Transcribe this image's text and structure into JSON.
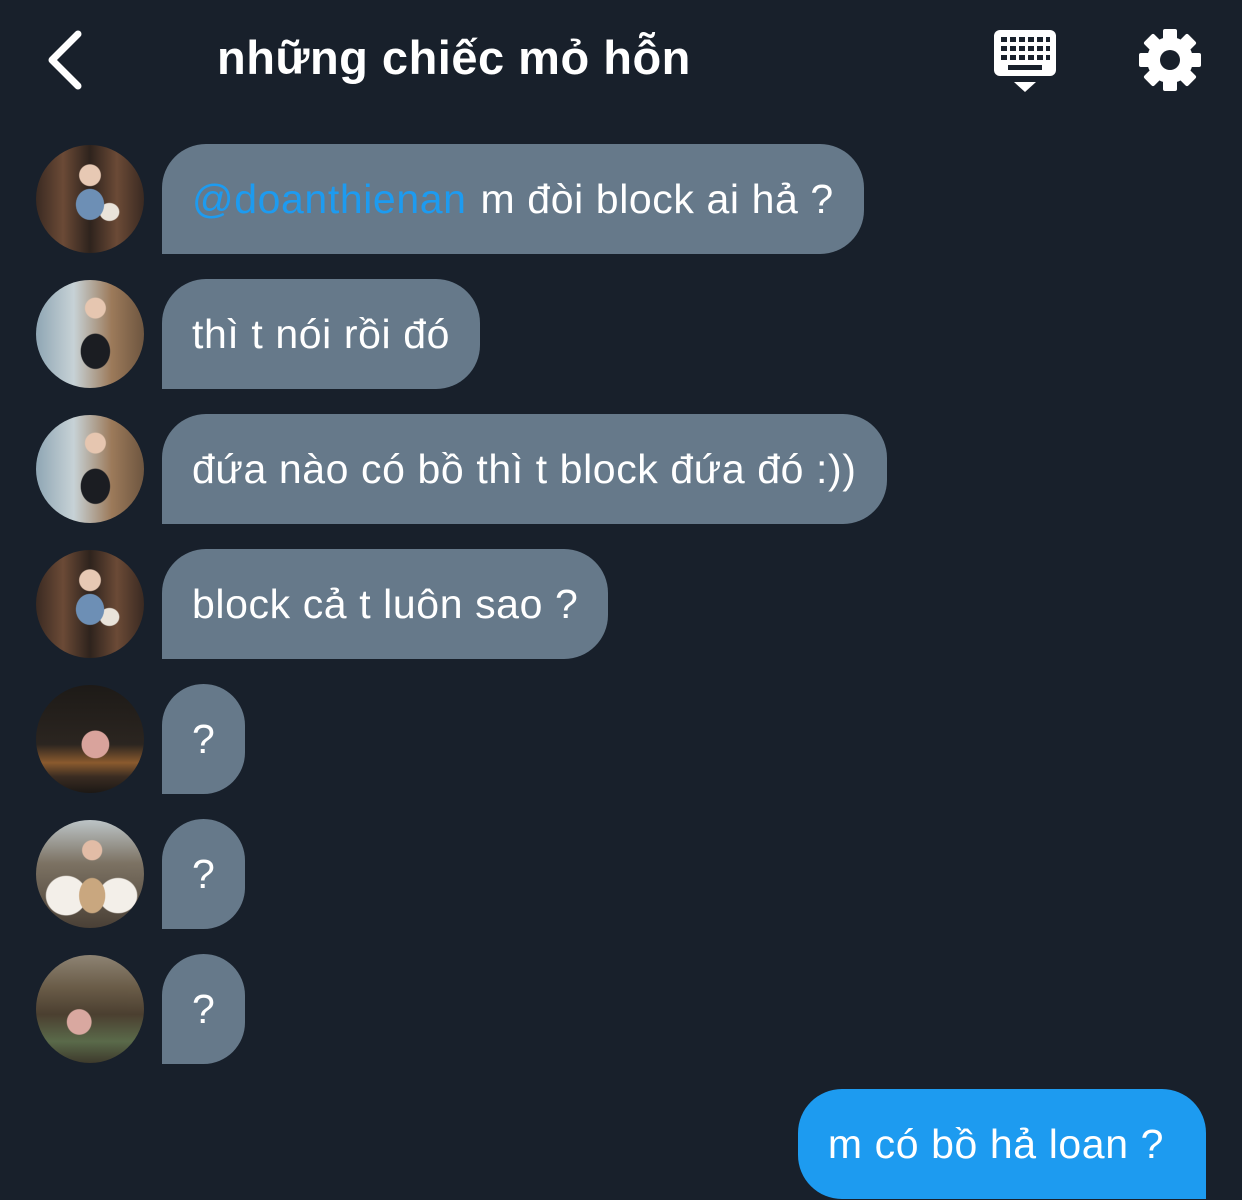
{
  "header": {
    "title": "những chiếc mỏ hỗn",
    "back_icon": "chevron-left-icon",
    "keyboard_icon": "keyboard-icon",
    "settings_icon": "gear-icon"
  },
  "messages": [
    {
      "mention": "@doanthienan",
      "text": "m đòi block ai hả ?"
    },
    {
      "text": "thì t nói rồi đó"
    },
    {
      "text": "đứa nào có bồ thì t block đứa đó :))"
    },
    {
      "text": "block cả t luôn sao ?"
    },
    {
      "text": "?"
    },
    {
      "text": "?"
    },
    {
      "text": "?"
    }
  ],
  "self_message": {
    "text": "m có bồ hả loan ?"
  },
  "colors": {
    "background": "#18202b",
    "bubble": "#66798a",
    "self_bubble": "#1d9bf0",
    "mention": "#1d9bf0"
  }
}
